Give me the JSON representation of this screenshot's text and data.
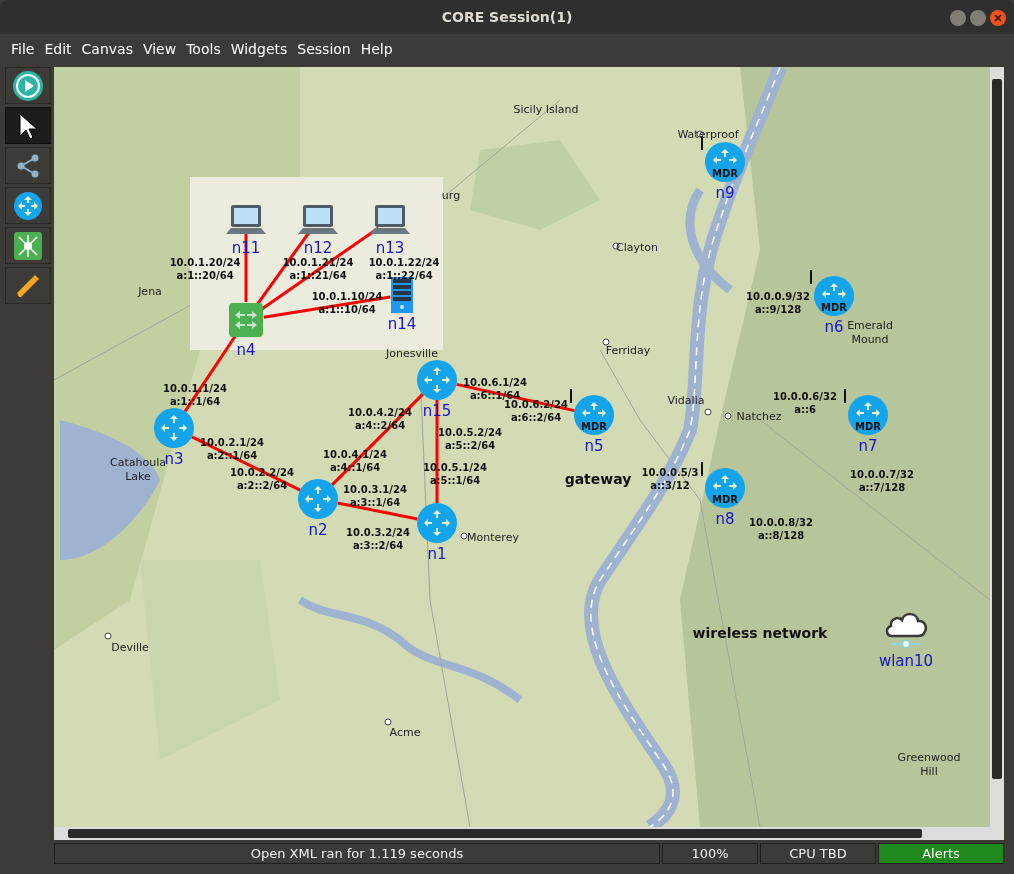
{
  "window": {
    "title": "CORE Session(1)"
  },
  "menu": [
    "File",
    "Edit",
    "Canvas",
    "View",
    "Tools",
    "Widgets",
    "Session",
    "Help"
  ],
  "toolbar": [
    {
      "kind": "start",
      "selected": false
    },
    {
      "kind": "select",
      "selected": true
    },
    {
      "kind": "link",
      "selected": false
    },
    {
      "kind": "router",
      "selected": false
    },
    {
      "kind": "network",
      "selected": false
    },
    {
      "kind": "marker",
      "selected": false
    }
  ],
  "map_labels": [
    "Sicily Island",
    "urg",
    "Jena",
    "Clayton",
    "Waterproof",
    "Ferriday",
    "Jonesville",
    "Vidalia",
    "Natchez",
    "Emerald Mound",
    "Catahoula Lake",
    "Monterey",
    "Deville",
    "Acme",
    "Greenwood Hill"
  ],
  "nodes": [
    {
      "name": "n4",
      "kind": "switch"
    },
    {
      "name": "n11",
      "kind": "laptop"
    },
    {
      "name": "n12",
      "kind": "laptop"
    },
    {
      "name": "n13",
      "kind": "laptop"
    },
    {
      "name": "n14",
      "kind": "server"
    },
    {
      "name": "n3",
      "kind": "router"
    },
    {
      "name": "n2",
      "kind": "router"
    },
    {
      "name": "n1",
      "kind": "router"
    },
    {
      "name": "n15",
      "kind": "router"
    },
    {
      "name": "n5",
      "kind": "mdr",
      "badge": "MDR"
    },
    {
      "name": "n9",
      "kind": "mdr",
      "badge": "MDR"
    },
    {
      "name": "n6",
      "kind": "mdr",
      "badge": "MDR"
    },
    {
      "name": "n7",
      "kind": "mdr",
      "badge": "MDR"
    },
    {
      "name": "n8",
      "kind": "mdr",
      "badge": "MDR"
    },
    {
      "name": "wlan10",
      "kind": "wlan"
    }
  ],
  "addresses": [
    {
      "ipv4": "10.0.1.20/24",
      "ipv6": "a:1::20/64"
    },
    {
      "ipv4": "10.0.1.21/24",
      "ipv6": "a:1::21/64"
    },
    {
      "ipv4": "10.0.1.22/24",
      "ipv6": "a:1::22/64"
    },
    {
      "ipv4": "10.0.1.10/24",
      "ipv6": "a:1::10/64"
    },
    {
      "ipv4": "10.0.1.1/24",
      "ipv6": "a:1::1/64"
    },
    {
      "ipv4": "10.0.2.1/24",
      "ipv6": "a:2::1/64"
    },
    {
      "ipv4": "10.0.2.2/24",
      "ipv6": "a:2::2/64"
    },
    {
      "ipv4": "10.0.4.1/24",
      "ipv6": "a:4::1/64"
    },
    {
      "ipv4": "10.0.4.2/24",
      "ipv6": "a:4::2/64"
    },
    {
      "ipv4": "10.0.5.2/24",
      "ipv6": "a:5::2/64"
    },
    {
      "ipv4": "10.0.3.1/24",
      "ipv6": "a:3::1/64"
    },
    {
      "ipv4": "10.0.3.2/24",
      "ipv6": "a:3::2/64"
    },
    {
      "ipv4": "10.0.5.1/24",
      "ipv6": "a:5::1/64"
    },
    {
      "ipv4": "10.0.6.1/24",
      "ipv6": "a:6::1/64"
    },
    {
      "ipv4": "10.0.6.2/24",
      "ipv6": "a:6::2/64"
    },
    {
      "ipv4": "10.0.0.9/32",
      "ipv6": "a::9/128"
    },
    {
      "ipv4": "10.0.0.6/32",
      "ipv6": "a::6"
    },
    {
      "ipv4": "10.0.0.5/3",
      "ipv6": "a::3/12"
    },
    {
      "ipv4": "10.0.0.7/32",
      "ipv6": "a::7/128"
    },
    {
      "ipv4": "10.0.0.8/32",
      "ipv6": "a::8/128"
    }
  ],
  "annotations": [
    "gateway",
    "wireless network"
  ],
  "status_bar": {
    "message": "Open XML ran for 1.119 seconds",
    "zoom": "100%",
    "cpu": "CPU TBD",
    "alerts": "Alerts"
  }
}
